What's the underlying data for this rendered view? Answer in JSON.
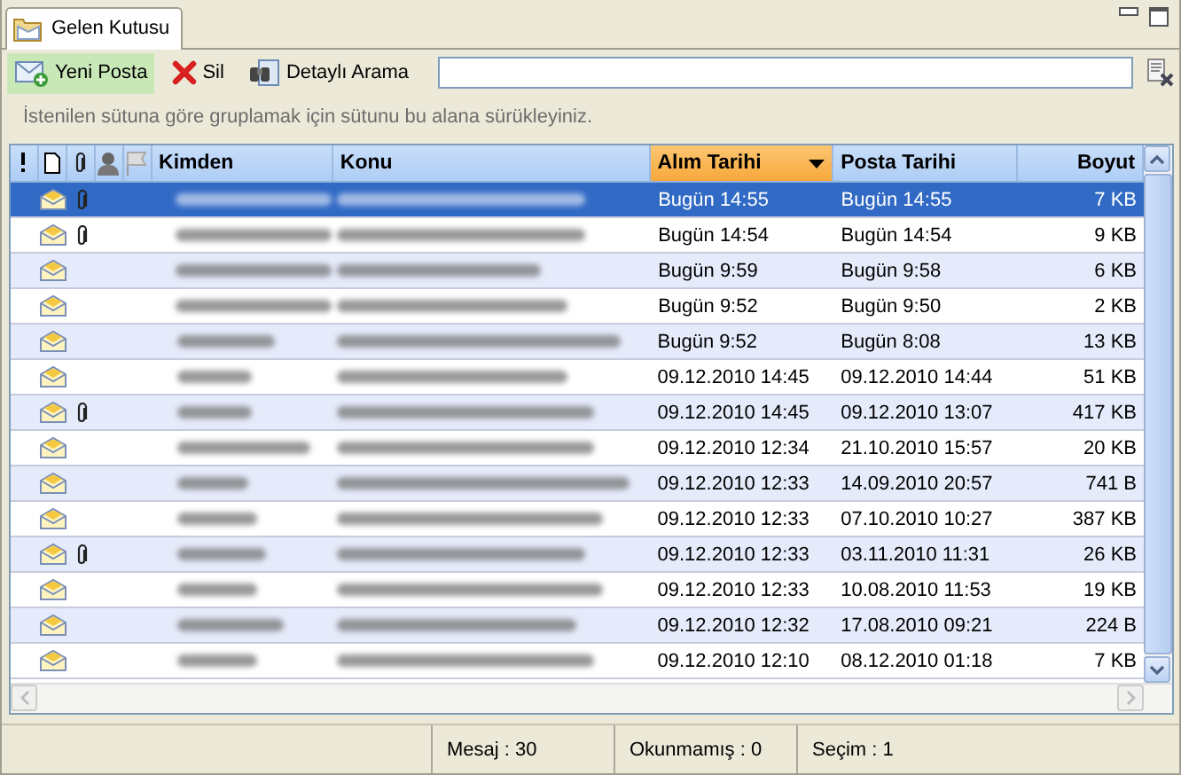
{
  "tab": {
    "label": "Gelen Kutusu",
    "selected": true
  },
  "toolbar": {
    "buttons": [
      {
        "label": "Yeni Posta",
        "kind": "new",
        "hover": true
      },
      {
        "label": "Sil",
        "kind": "delete",
        "hover": false
      },
      {
        "label": "Detaylı Arama",
        "kind": "search",
        "hover": false
      }
    ]
  },
  "group_hint": "İstenilen sütuna göre gruplamak için sütunu bu alana sürükleyiniz.",
  "columns": [
    {
      "label": "Kimden",
      "sorted": false
    },
    {
      "label": "Konu",
      "sorted": false
    },
    {
      "label": "Alım Tarihi",
      "sorted": true
    },
    {
      "label": "Posta Tarihi",
      "sorted": false
    },
    {
      "label": "Boyut",
      "sorted": false
    }
  ],
  "rows": [
    {
      "selected": true,
      "attachment": true,
      "received": "Bugün 14:55",
      "sent": "Bugün 14:55",
      "size": "7 KB"
    },
    {
      "selected": false,
      "attachment": true,
      "received": "Bugün 14:54",
      "sent": "Bugün 14:54",
      "size": "9 KB"
    },
    {
      "selected": false,
      "attachment": false,
      "received": "Bugün 9:59",
      "sent": "Bugün 9:58",
      "size": "6 KB"
    },
    {
      "selected": false,
      "attachment": false,
      "received": "Bugün 9:52",
      "sent": "Bugün 9:50",
      "size": "2 KB"
    },
    {
      "selected": false,
      "attachment": false,
      "received": "Bugün 9:52",
      "sent": "Bugün 8:08",
      "size": "13 KB"
    },
    {
      "selected": false,
      "attachment": false,
      "received": "09.12.2010 14:45",
      "sent": "09.12.2010 14:44",
      "size": "51 KB"
    },
    {
      "selected": false,
      "attachment": true,
      "received": "09.12.2010 14:45",
      "sent": "09.12.2010 13:07",
      "size": "417 KB"
    },
    {
      "selected": false,
      "attachment": false,
      "received": "09.12.2010 12:34",
      "sent": "21.10.2010 15:57",
      "size": "20 KB"
    },
    {
      "selected": false,
      "attachment": false,
      "received": "09.12.2010 12:33",
      "sent": "14.09.2010 20:57",
      "size": "741 B"
    },
    {
      "selected": false,
      "attachment": false,
      "received": "09.12.2010 12:33",
      "sent": "07.10.2010 10:27",
      "size": "387 KB"
    },
    {
      "selected": false,
      "attachment": true,
      "received": "09.12.2010 12:33",
      "sent": "03.11.2010 11:31",
      "size": "26 KB"
    },
    {
      "selected": false,
      "attachment": false,
      "received": "09.12.2010 12:33",
      "sent": "10.08.2010 11:53",
      "size": "19 KB"
    },
    {
      "selected": false,
      "attachment": false,
      "received": "09.12.2010 12:32",
      "sent": "17.08.2010 09:21",
      "size": "224 B"
    },
    {
      "selected": false,
      "attachment": false,
      "received": "09.12.2010 12:10",
      "sent": "08.12.2010 01:18",
      "size": "7 KB"
    }
  ],
  "status_bar": [
    "Mesaj : 30",
    "Okunmamış : 0",
    "Seçim : 1"
  ]
}
